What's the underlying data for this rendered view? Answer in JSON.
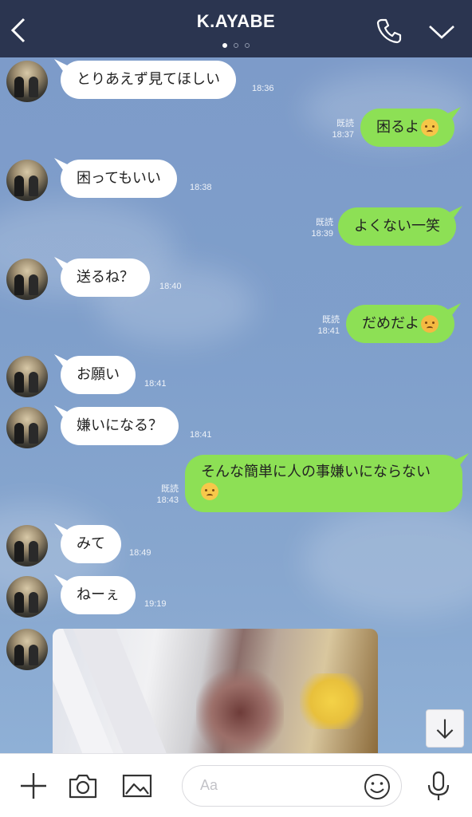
{
  "header": {
    "title": "K.AYABE",
    "page_indicator": {
      "count": 3,
      "active": 1
    }
  },
  "messages": [
    {
      "side": "in",
      "text": "とりあえず見てほしい",
      "time": "18:36"
    },
    {
      "side": "out",
      "text": "困るよ",
      "emoji": "tired-face-emoji",
      "read": "既読",
      "time": "18:37"
    },
    {
      "side": "in",
      "text": "困ってもいい",
      "time": "18:38"
    },
    {
      "side": "out",
      "text": "よくない一笑",
      "read": "既読",
      "time": "18:39"
    },
    {
      "side": "in",
      "text": "送るね？",
      "time": "18:40"
    },
    {
      "side": "out",
      "text": "だめだよ",
      "emoji": "confounded-face-emoji",
      "read": "既読",
      "time": "18:41"
    },
    {
      "side": "in",
      "text": "お願い",
      "time": "18:41"
    },
    {
      "side": "in",
      "text": "嫌いになる？",
      "time": "18:41"
    },
    {
      "side": "out",
      "text": "そんな簡単に人の事嫌いにならない",
      "emoji": "relieved-face-emoji",
      "read": "既読",
      "time": "18:43"
    },
    {
      "side": "in",
      "text": "みて",
      "time": "18:49"
    },
    {
      "side": "in",
      "text": "ねーぇ",
      "time": "19:19"
    },
    {
      "side": "in",
      "type": "photo",
      "blurred": true
    }
  ],
  "composer": {
    "placeholder": "Aa",
    "icons": [
      "plus-icon",
      "camera-icon",
      "image-icon",
      "smiley-icon",
      "microphone-icon"
    ]
  },
  "colors": {
    "header_bg": "#2b3550",
    "chat_bg": "#7b9cc9",
    "incoming_bubble": "#ffffff",
    "outgoing_bubble": "#8de055"
  }
}
